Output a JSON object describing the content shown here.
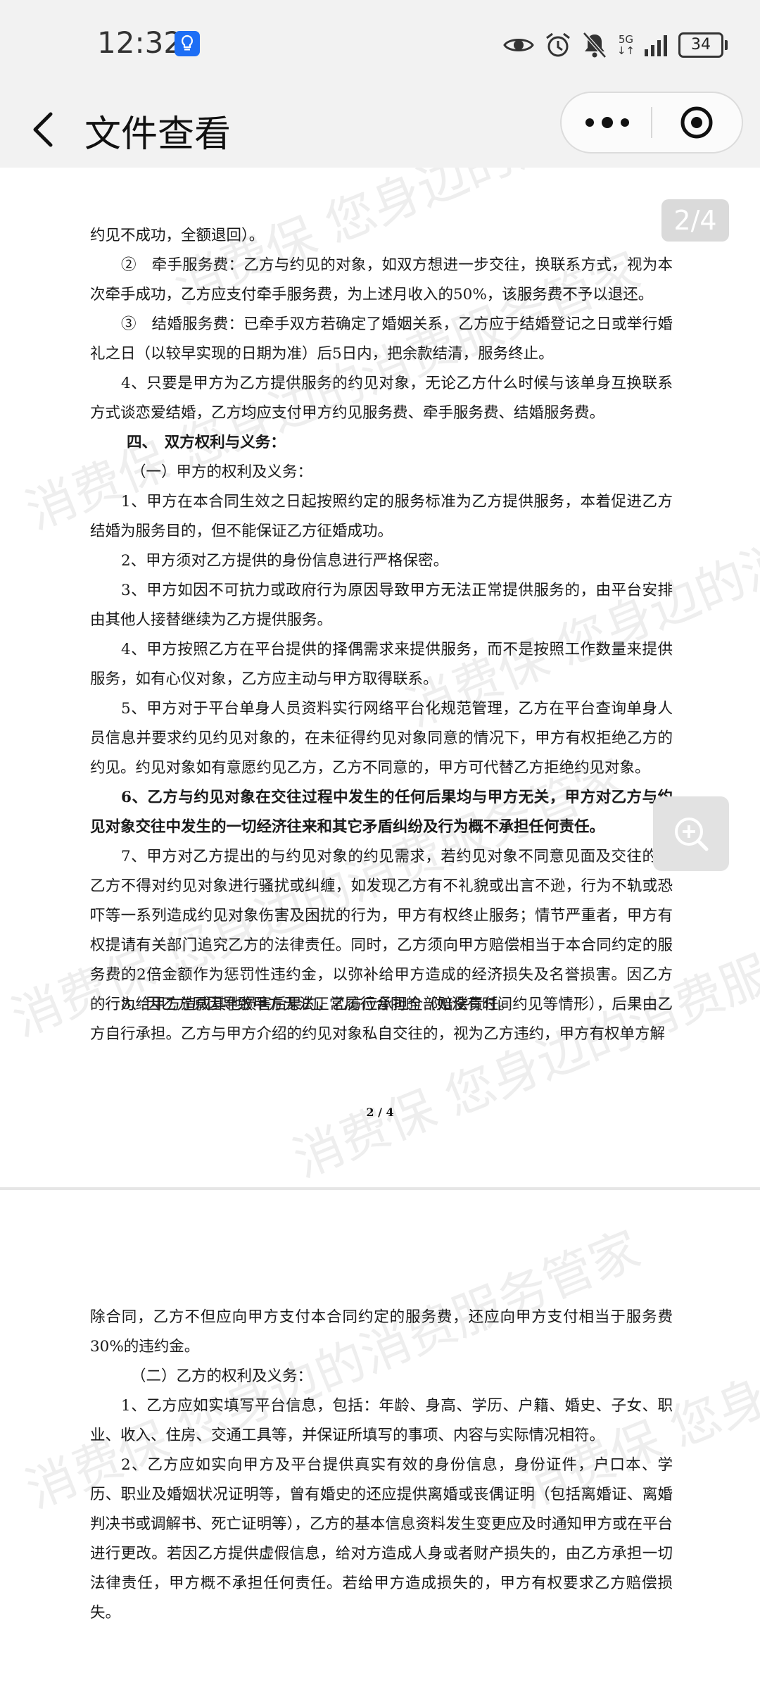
{
  "status_bar": {
    "time": "12:32",
    "battery": "34",
    "network": "5G",
    "icons": [
      "notification-app-icon",
      "eye-icon",
      "alarm-icon",
      "mute-bell-icon",
      "signal-icon",
      "battery-icon"
    ]
  },
  "header": {
    "title": "文件查看",
    "back_icon": "chevron-left-icon",
    "more_icon": "more-dots-icon",
    "close_icon": "target-circle-icon"
  },
  "document": {
    "page_indicator": "2/4",
    "page_number_footer": "2 / 4",
    "watermark": "消费保 您身边的消费服务管家",
    "page2": {
      "p1": "约见不成功，全额退回）。",
      "p2": "②　牵手服务费：乙方与约见的对象，如双方想进一步交往，换联系方式，视为本次牵手成功，乙方应支付牵手服务费，为上述月收入的50%，该服务费不予以退还。",
      "p3": "③　结婚服务费：已牵手双方若确定了婚姻关系，乙方应于结婚登记之日或举行婚礼之日（以较早实现的日期为准）后5日内，把余款结清，服务终止。",
      "p4": "4、只要是甲方为乙方提供服务的约见对象，无论乙方什么时候与该单身互换联系方式谈恋爱结婚，乙方均应支付甲方约见服务费、牵手服务费、结婚服务费。",
      "h4": "四、　双方权利与义务：",
      "h4_1": "（一）甲方的权利及义务：",
      "a1": "1、甲方在本合同生效之日起按照约定的服务标准为乙方提供服务，本着促进乙方结婚为服务目的，但不能保证乙方征婚成功。",
      "a2": "2、甲方须对乙方提供的身份信息进行严格保密。",
      "a3": "3、甲方如因不可抗力或政府行为原因导致甲方无法正常提供服务的，由平台安排由其他人接替继续为乙方提供服务。",
      "a4": "4、甲方按照乙方在平台提供的择偶需求来提供服务，而不是按照工作数量来提供服务，如有心仪对象，乙方应主动与甲方取得联系。",
      "a5": "5、甲方对于平台单身人员资料实行网络平台化规范管理，乙方在平台查询单身人员信息并要求约见约见对象的，在未征得约见对象同意的情况下，甲方有权拒绝乙方的约见。约见对象如有意愿约见乙方，乙方不同意的，甲方可代替乙方拒绝约见对象。",
      "a6": "6、乙方与约见对象在交往过程中发生的任何后果均与甲方无关，甲方对乙方与约见对象交往中发生的一切经济往来和其它矛盾纠纷及行为概不承担任何责任。",
      "a7": "7、甲方对乙方提出的与约见对象的约见需求，若约见对象不同意见面及交往的，乙方不得对约见对象进行骚扰或纠缠，如发现乙方有不礼貌或出言不逊，行为不轨或恐吓等一系列造成约见对象伤害及困扰的行为，甲方有权终止服务；情节严重者，甲方有权提请有关部门追究乙方的法律责任。同时，乙方须向甲方赔偿相当于本合同约定的服务费的2倍金额作为惩罚性违约金，以弥补给甲方造成的经济损失及名誉损害。因乙方的行为给甲方造成其他损害后果的，乙方应承担全部赔偿责任。",
      "a8": "8、因乙方原因导致甲方无法正常履行合同的（如没有时间约见等情形），后果由乙方自行承担。乙方与甲方介绍的约见对象私自交往的，视为乙方违约，甲方有权单方解"
    },
    "page3": {
      "p1": "除合同，乙方不但应向甲方支付本合同约定的服务费，还应向甲方支付相当于服务费30%的违约金。",
      "h": "（二）乙方的权利及义务：",
      "b1": "1、乙方应如实填写平台信息，包括：年龄、身高、学历、户籍、婚史、子女、职业、收入、住房、交通工具等，并保证所填写的事项、内容与实际情况相符。",
      "b2": "2、乙方应如实向甲方及平台提供真实有效的身份信息，身份证件，户口本、学历、职业及婚姻状况证明等，曾有婚史的还应提供离婚或丧偶证明（包括离婚证、离婚判决书或调解书、死亡证明等），乙方的基本信息资料发生变更应及时通知甲方或在平台进行更改。若因乙方提供虚假信息，给对方造成人身或者财产损失的，由乙方承担一切法律责任，甲方概不承担任何责任。若给甲方造成损失的，甲方有权要求乙方赔偿损失。"
    },
    "zoom_icon": "zoom-in-icon"
  }
}
